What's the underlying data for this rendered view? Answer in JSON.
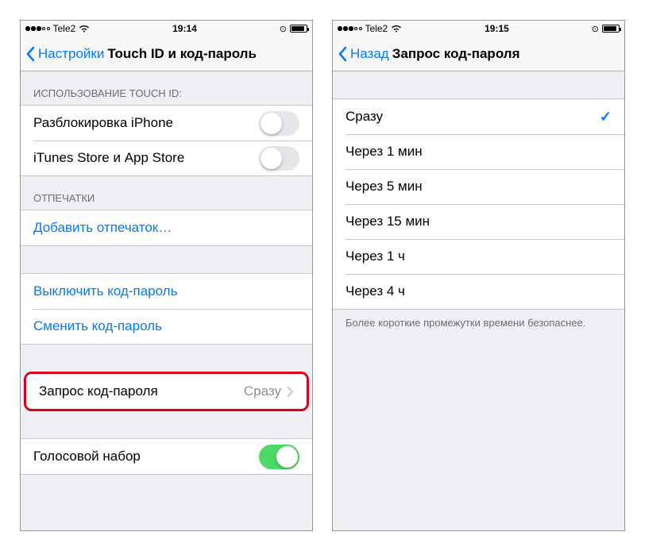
{
  "left": {
    "status": {
      "carrier": "Tele2",
      "time": "19:14"
    },
    "nav": {
      "back": "Настройки",
      "title": "Touch ID и код-пароль"
    },
    "section_touchid_header": "ИСПОЛЬЗОВАНИЕ TOUCH ID:",
    "touchid": {
      "unlock": "Разблокировка iPhone",
      "store": "iTunes Store и App Store"
    },
    "section_fingerprints_header": "ОТПЕЧАТКИ",
    "fingerprints": {
      "add": "Добавить отпечаток…"
    },
    "passcode": {
      "turnoff": "Выключить код-пароль",
      "change": "Сменить код-пароль",
      "require_label": "Запрос код-пароля",
      "require_value": "Сразу"
    },
    "voice": {
      "label": "Голосовой набор"
    }
  },
  "right": {
    "status": {
      "carrier": "Tele2",
      "time": "19:15"
    },
    "nav": {
      "back": "Назад",
      "title": "Запрос код-пароля"
    },
    "options": [
      {
        "label": "Сразу",
        "selected": true
      },
      {
        "label": "Через 1 мин",
        "selected": false
      },
      {
        "label": "Через 5 мин",
        "selected": false
      },
      {
        "label": "Через 15 мин",
        "selected": false
      },
      {
        "label": "Через 1 ч",
        "selected": false
      },
      {
        "label": "Через 4 ч",
        "selected": false
      }
    ],
    "footer": "Более короткие промежутки времени безопаснее."
  }
}
